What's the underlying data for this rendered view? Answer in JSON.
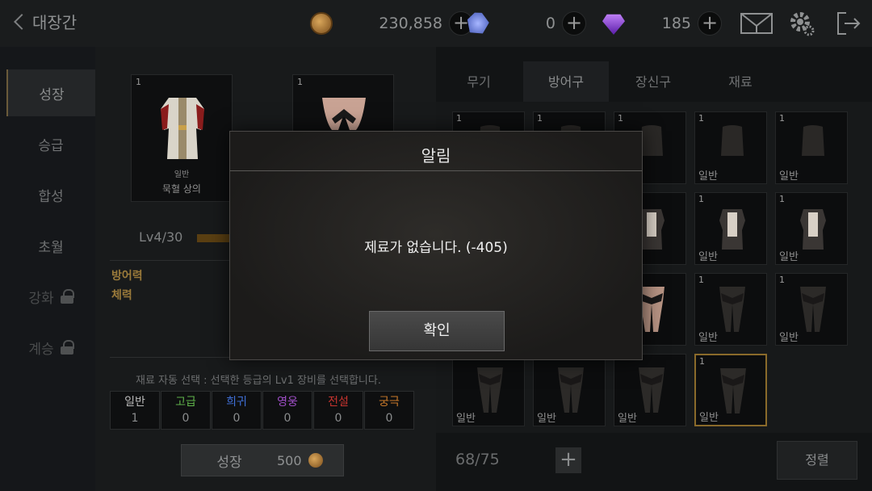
{
  "header": {
    "title": "대장간",
    "gold": "230,858",
    "crystal": "0",
    "gem": "185",
    "colors": {
      "accent_gold": "#c89a4e",
      "gem_purple": "#8a3df0",
      "crystal_blue": "#6a80e8"
    }
  },
  "sidebar": {
    "items": [
      {
        "label": "성장",
        "active": true,
        "locked": false
      },
      {
        "label": "승급",
        "active": false,
        "locked": false
      },
      {
        "label": "합성",
        "active": false,
        "locked": false
      },
      {
        "label": "초월",
        "active": false,
        "locked": false
      },
      {
        "label": "강화",
        "active": false,
        "locked": true
      },
      {
        "label": "계승",
        "active": false,
        "locked": true
      }
    ]
  },
  "growth": {
    "main_item": {
      "count": "1",
      "grade": "일반",
      "name": "묵혈 상의"
    },
    "material_slot": {
      "count": "1"
    },
    "level": "Lv4/30",
    "stats": [
      "방어력",
      "체력"
    ],
    "auto_select_note": "재료 자동 선택 : 선택한 등급의 Lv1 장비를 선택합니다.",
    "grades": [
      {
        "label": "일반",
        "count": "1",
        "color": "#b8b8b8"
      },
      {
        "label": "고급",
        "count": "0",
        "color": "#5fb24a"
      },
      {
        "label": "희귀",
        "count": "0",
        "color": "#3f6fd6"
      },
      {
        "label": "영웅",
        "count": "0",
        "color": "#a04fc8"
      },
      {
        "label": "전설",
        "count": "0",
        "color": "#c8342f"
      },
      {
        "label": "궁극",
        "count": "0",
        "color": "#c97a2a"
      }
    ],
    "grow_button": {
      "label": "성장",
      "cost": "500"
    }
  },
  "inventory": {
    "tabs": [
      {
        "label": "무기",
        "active": false
      },
      {
        "label": "방어구",
        "active": true
      },
      {
        "label": "장신구",
        "active": false
      },
      {
        "label": "재료",
        "active": false
      }
    ],
    "items": [
      {
        "n": "1",
        "g": ""
      },
      {
        "n": "1",
        "g": ""
      },
      {
        "n": "1",
        "g": ""
      },
      {
        "n": "1",
        "g": "일반"
      },
      {
        "n": "1",
        "g": "일반"
      },
      {
        "n": "",
        "g": ""
      },
      {
        "n": "",
        "g": ""
      },
      {
        "n": "",
        "g": ""
      },
      {
        "n": "1",
        "g": "일반"
      },
      {
        "n": "1",
        "g": "일반"
      },
      {
        "n": "",
        "g": ""
      },
      {
        "n": "",
        "g": ""
      },
      {
        "n": "",
        "g": ""
      },
      {
        "n": "1",
        "g": "일반"
      },
      {
        "n": "1",
        "g": "일반"
      },
      {
        "n": "",
        "g": "일반"
      },
      {
        "n": "",
        "g": "일반"
      },
      {
        "n": "",
        "g": "일반"
      },
      {
        "n": "1",
        "g": "일반"
      }
    ],
    "capacity": "68/75",
    "sort_label": "정렬"
  },
  "dialog": {
    "title": "알림",
    "message": "제료가 없습니다. (-405)",
    "confirm_label": "확인"
  }
}
